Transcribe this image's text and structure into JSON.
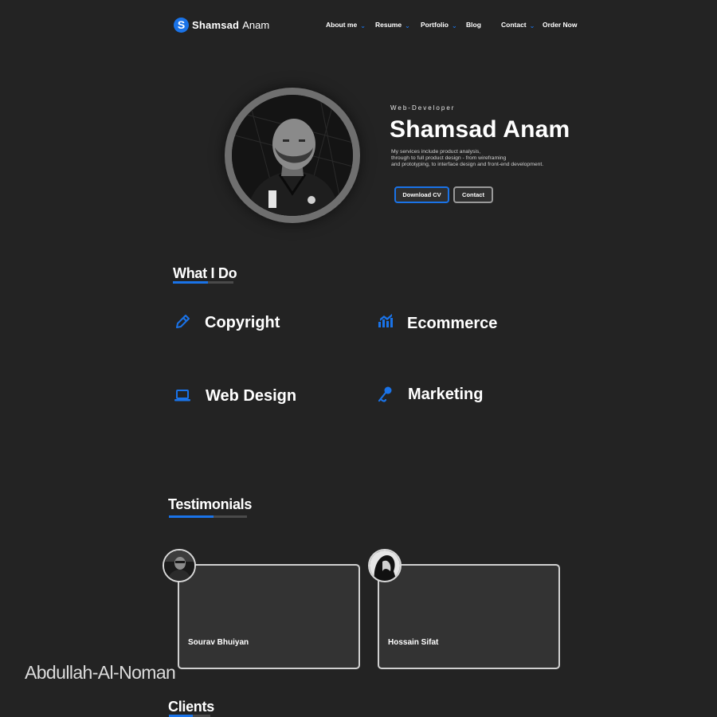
{
  "brand": {
    "badge_letter": "S",
    "first_name": "Shamsad",
    "last_name": "Anam",
    "accent_color": "#1a73e8"
  },
  "nav": {
    "items": [
      {
        "label": "About me",
        "has_dropdown": true
      },
      {
        "label": "Resume",
        "has_dropdown": true
      },
      {
        "label": "Portfolio",
        "has_dropdown": true
      },
      {
        "label": "Blog",
        "has_dropdown": false
      },
      {
        "label": "Contact",
        "has_dropdown": true
      },
      {
        "label": "Order Now",
        "has_dropdown": false
      }
    ]
  },
  "hero": {
    "role": "Web-Developer",
    "name": "Shamsad Anam",
    "description_lines": [
      "My services include product analysis,",
      "through to full product design - from wireframing",
      "and prototyping, to interface design and front-end development."
    ],
    "download_label": "Download CV",
    "contact_label": "Contact"
  },
  "what_i_do": {
    "title": "What I Do",
    "services": [
      {
        "label": "Copyright",
        "icon": "pencil-icon"
      },
      {
        "label": "Ecommerce",
        "icon": "chart-icon"
      },
      {
        "label": "Web Design",
        "icon": "laptop-icon"
      },
      {
        "label": "Marketing",
        "icon": "microphone-icon"
      }
    ]
  },
  "testimonials": {
    "title": "Testimonials",
    "items": [
      {
        "name": "Sourav Bhuiyan"
      },
      {
        "name": "Hossain Sifat"
      }
    ]
  },
  "clients": {
    "title": "Clients"
  },
  "watermark": "Abdullah-Al-Noman"
}
